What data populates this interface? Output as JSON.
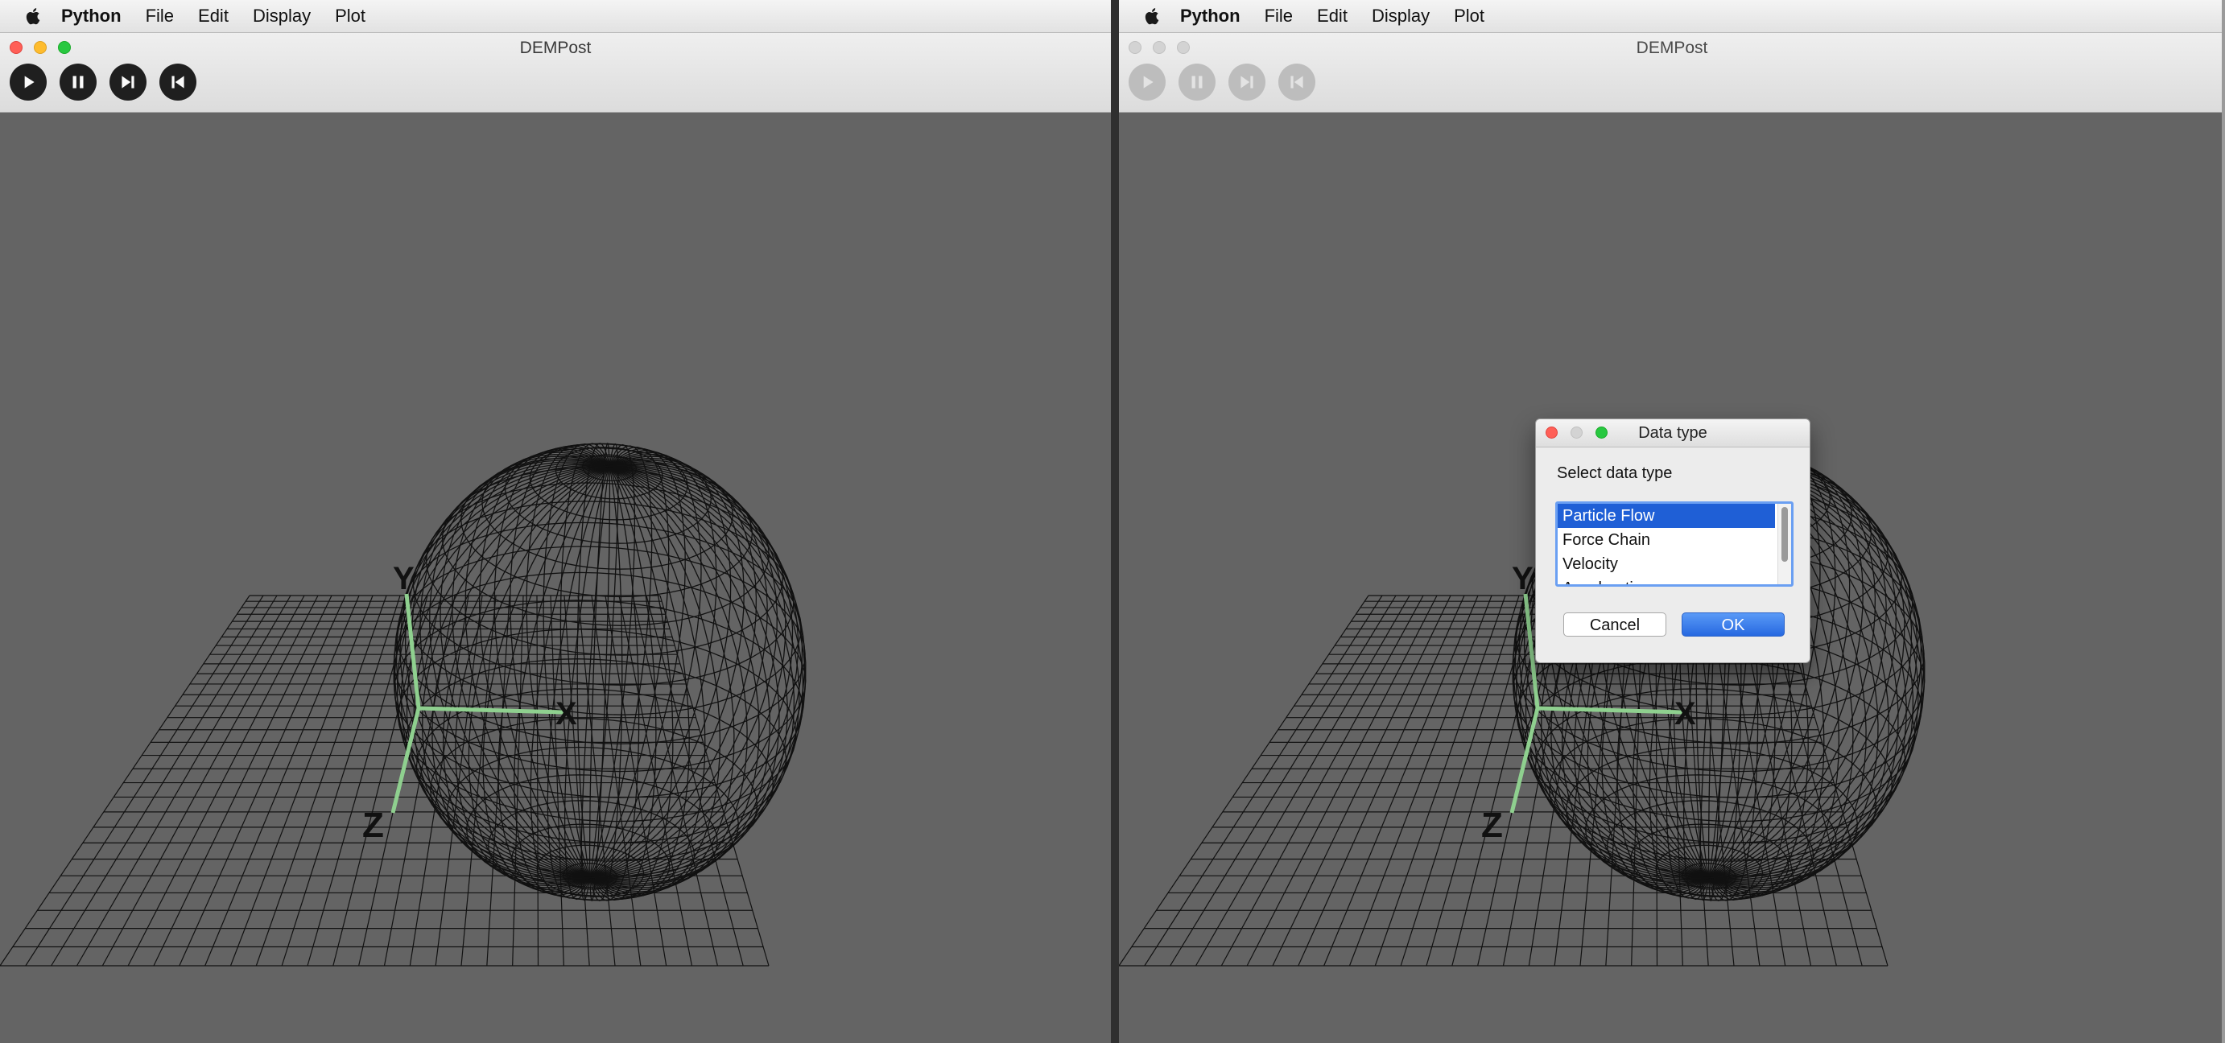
{
  "menubar": {
    "app_name": "Python",
    "items": [
      "File",
      "Edit",
      "Display",
      "Plot"
    ]
  },
  "left_window": {
    "title": "DEMPost",
    "toolbar": [
      "play-icon",
      "pause-icon",
      "step-forward-icon",
      "step-back-icon"
    ]
  },
  "right_window": {
    "title": "DEMPost",
    "toolbar": [
      "play-icon",
      "pause-icon",
      "step-forward-icon",
      "step-back-icon"
    ]
  },
  "scene": {
    "axis_labels": {
      "x": "X",
      "y": "Y",
      "z": "Z"
    },
    "colors": {
      "background": "#646464",
      "wireframe": "#111111",
      "axis": "#8fd08f"
    }
  },
  "dialog": {
    "title": "Data type",
    "prompt": "Select data type",
    "options": [
      "Particle Flow",
      "Force Chain",
      "Velocity",
      "Acceleration"
    ],
    "selected": "Particle Flow",
    "cancel_label": "Cancel",
    "ok_label": "OK",
    "accent": "#1f5fd6"
  }
}
